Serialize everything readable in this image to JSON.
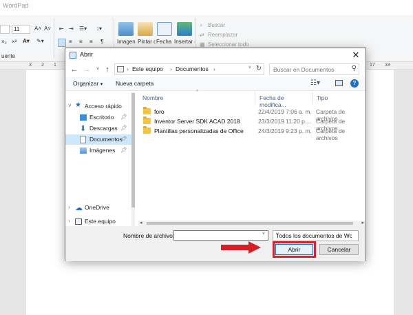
{
  "app": {
    "title": "WordPad"
  },
  "ribbon": {
    "font_size": "11",
    "paragraph_label": "uente",
    "insert": {
      "image_label": "Imagen",
      "paint_label": "Pintar dibujo",
      "datetime_label": "Fecha y hora",
      "object_label": "Insertar objeto"
    },
    "edit": {
      "find": "Buscar",
      "replace": "Reemplazar",
      "select_all": "Seleccionar todo"
    }
  },
  "ruler": {
    "marks": [
      "3",
      "2",
      "1",
      "17",
      "18"
    ]
  },
  "dialog": {
    "title": "Abrir",
    "address": {
      "segments": [
        "Este equipo",
        "Documentos"
      ]
    },
    "search_placeholder": "Buscar en Documentos",
    "toolbar": {
      "organize": "Organizar",
      "new_folder": "Nueva carpeta"
    },
    "nav": {
      "quick_access": "Acceso rápido",
      "items": [
        "Escritorio",
        "Descargas",
        "Documentos",
        "Imágenes"
      ],
      "onedrive": "OneDrive",
      "this_pc": "Este equipo"
    },
    "columns": {
      "name": "Nombre",
      "date": "Fecha de modifica...",
      "type": "Tipo"
    },
    "files": [
      {
        "name": "foro",
        "date": "22/4/2019 7:06 a. m.",
        "type": "Carpeta de archivos"
      },
      {
        "name": "Inventor Server SDK ACAD 2018",
        "date": "23/3/2019 11:20 p....",
        "type": "Carpeta de archivos"
      },
      {
        "name": "Plantillas personalizadas de Office",
        "date": "24/3/2019 9:23 p. m.",
        "type": "Carpeta de archivos"
      }
    ],
    "filename_label": "Nombre de archivo:",
    "filename_value": "",
    "filetype": "Todos los documentos de Word",
    "open_button": "Abrir",
    "cancel_button": "Cancelar"
  },
  "colors": {
    "selection": "#cce8ff",
    "highlight": "#d8212b",
    "accent": "#0078d7",
    "folder": "#f4c542"
  }
}
